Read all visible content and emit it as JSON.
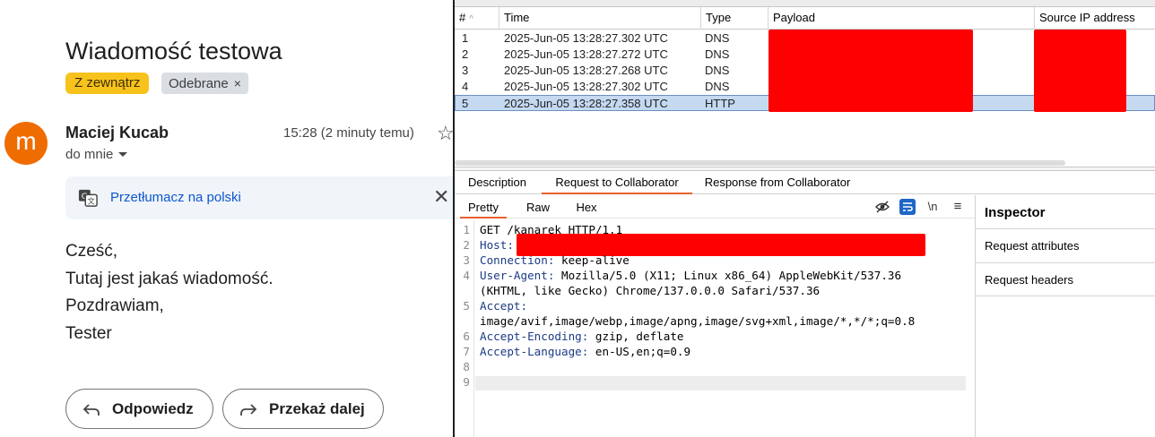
{
  "mail": {
    "subject": "Wiadomość testowa",
    "labels": [
      {
        "text": "Z zewnątrz",
        "color": "#f8c21c"
      },
      {
        "text": "Odebrane",
        "remove_glyph": "×"
      }
    ],
    "avatar_letter": "m",
    "avatar_color": "#ef6c00",
    "sender": "Maciej Kucab",
    "time": "15:28 (2 minuty temu)",
    "star_glyph": "☆",
    "to": "do mnie",
    "translate_label": "Przetłumacz na polski",
    "close_glyph": "✕",
    "body_lines": [
      "Cześć,",
      "Tutaj jest jakaś wiadomość.",
      "Pozdrawiam,",
      "Tester"
    ],
    "actions": {
      "reply": "Odpowiedz",
      "forward": "Przekaż dalej"
    }
  },
  "burp": {
    "columns": [
      "#",
      "Time",
      "Type",
      "Payload",
      "Source IP address"
    ],
    "sort_glyph": "^",
    "rows": [
      {
        "n": "1",
        "time": "2025-Jun-05 13:28:27.302 UTC",
        "type": "DNS"
      },
      {
        "n": "2",
        "time": "2025-Jun-05 13:28:27.272 UTC",
        "type": "DNS"
      },
      {
        "n": "3",
        "time": "2025-Jun-05 13:28:27.268 UTC",
        "type": "DNS"
      },
      {
        "n": "4",
        "time": "2025-Jun-05 13:28:27.302 UTC",
        "type": "DNS"
      },
      {
        "n": "5",
        "time": "2025-Jun-05 13:28:27.358 UTC",
        "type": "HTTP",
        "selected": true
      }
    ],
    "detail_tabs": [
      "Description",
      "Request to Collaborator",
      "Response from Collaborator"
    ],
    "active_detail_tab": "Request to Collaborator",
    "view_tabs": [
      "Pretty",
      "Raw",
      "Hex"
    ],
    "active_view_tab": "Pretty",
    "toolbar": {
      "newline": "\\n",
      "menu": "≡"
    },
    "request_lines": [
      {
        "n": "1",
        "key": "",
        "value": "GET /kanarek HTTP/1.1"
      },
      {
        "n": "2",
        "key": "Host:",
        "value": ""
      },
      {
        "n": "3",
        "key": "Connection:",
        "value": " keep-alive"
      },
      {
        "n": "4",
        "key": "User-Agent:",
        "value": " Mozilla/5.0 (X11; Linux x86_64) AppleWebKit/537.36"
      },
      {
        "n": "",
        "key": "",
        "value": "(KHTML, like Gecko) Chrome/137.0.0.0 Safari/537.36"
      },
      {
        "n": "5",
        "key": "Accept:",
        "value": ""
      },
      {
        "n": "",
        "key": "",
        "value": "image/avif,image/webp,image/apng,image/svg+xml,image/*,*/*;q=0.8"
      },
      {
        "n": "6",
        "key": "Accept-Encoding:",
        "value": " gzip, deflate"
      },
      {
        "n": "7",
        "key": "Accept-Language:",
        "value": " en-US,en;q=0.9"
      },
      {
        "n": "8",
        "key": "",
        "value": ""
      },
      {
        "n": "9",
        "key": "",
        "value": ""
      }
    ],
    "inspector": {
      "title": "Inspector",
      "sections": [
        "Request attributes",
        "Request headers"
      ]
    },
    "accent_color": "#e8612c",
    "redaction_color": "#ff0000"
  }
}
